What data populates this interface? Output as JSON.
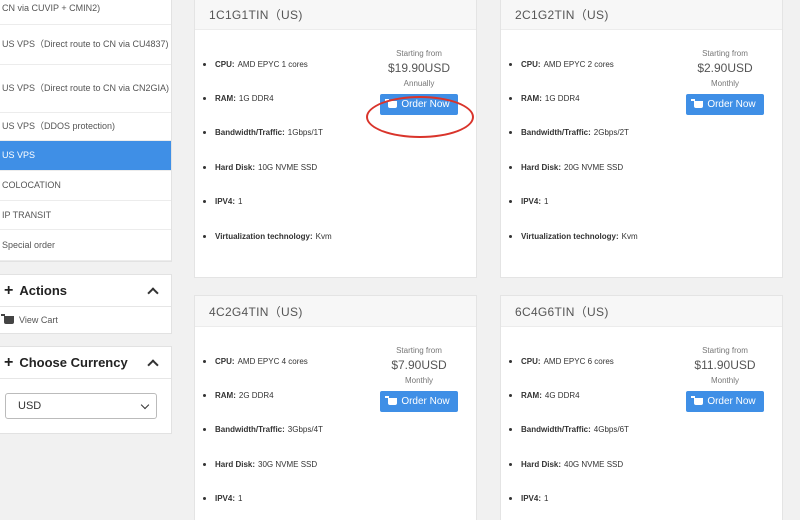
{
  "sidebar": {
    "categories": [
      {
        "label": "CN via CUVIP + CMIN2)"
      },
      {
        "label": "US VPS（Direct route to CN via CU4837)"
      },
      {
        "label": "US VPS（Direct route to CN via CN2GIA)"
      },
      {
        "label": "US VPS（DDOS protection)"
      },
      {
        "label": "US VPS"
      },
      {
        "label": "COLOCATION"
      },
      {
        "label": "IP TRANSIT"
      },
      {
        "label": "Special order"
      }
    ],
    "actions": {
      "title": "Actions",
      "view_cart": "View Cart"
    },
    "currency": {
      "title": "Choose Currency",
      "selected": "USD"
    }
  },
  "labels": {
    "cpu": "CPU:",
    "ram": "RAM:",
    "bandwidth": "Bandwidth/Traffic:",
    "disk": "Hard Disk:",
    "ipv4": "IPV4:",
    "virt": "Virtualization technology:",
    "starting_from": "Starting from",
    "order_now": "Order Now"
  },
  "products": [
    {
      "name": "1C1G1TIN（US)",
      "cpu": "AMD EPYC 1 cores",
      "ram": "1G DDR4",
      "bandwidth": "1Gbps/1T",
      "disk": "10G NVME SSD",
      "ipv4": "1",
      "virt": "Kvm",
      "price": "$19.90USD",
      "cycle": "Annually"
    },
    {
      "name": "2C1G2TIN（US)",
      "cpu": "AMD EPYC 2 cores",
      "ram": "1G DDR4",
      "bandwidth": "2Gbps/2T",
      "disk": "20G NVME SSD",
      "ipv4": "1",
      "virt": "Kvm",
      "price": "$2.90USD",
      "cycle": "Monthly"
    },
    {
      "name": "4C2G4TIN（US)",
      "cpu": "AMD EPYC 4 cores",
      "ram": "2G DDR4",
      "bandwidth": "3Gbps/4T",
      "disk": "30G NVME SSD",
      "ipv4": "1",
      "price": "$7.90USD",
      "cycle": "Monthly"
    },
    {
      "name": "6C4G6TIN（US)",
      "cpu": "AMD EPYC 6 cores",
      "ram": "4G DDR4",
      "bandwidth": "4Gbps/6T",
      "disk": "40G NVME SSD",
      "ipv4": "1",
      "price": "$11.90USD",
      "cycle": "Monthly"
    }
  ],
  "colors": {
    "accent": "#3f8fe6",
    "highlight_ring": "#d9342b"
  }
}
